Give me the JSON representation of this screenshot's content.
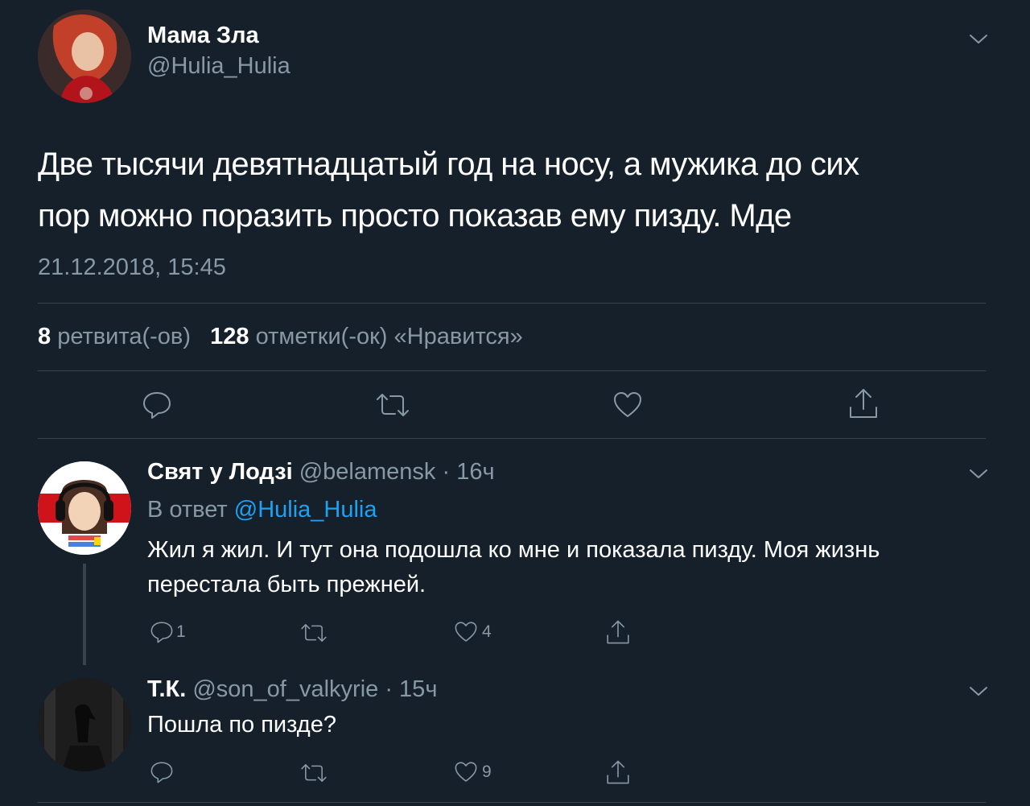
{
  "main_tweet": {
    "author_name": "Мама Зла",
    "author_handle": "@Hulia_Hulia",
    "text_line1": "Две тысячи девятнадцатый год на носу, а мужика до сих",
    "text_line2": "пор можно поразить просто показав ему пизду. Мде",
    "timestamp": "21.12.2018, 15:45",
    "retweets_count": "8",
    "retweets_label": "ретвита(-ов)",
    "likes_count": "128",
    "likes_label": "отметки(-ок) «Нравится»",
    "actions": [
      "reply-icon",
      "retweet-icon",
      "like-icon",
      "share-icon"
    ]
  },
  "replies": [
    {
      "author_name": "Свят у Лодзі",
      "author_handle": "@belamensk",
      "time": "· 16ч",
      "reply_to_prefix": "В ответ",
      "reply_to_handle": "@Hulia_Hulia",
      "text_line1": "Жил я жил. И тут она подошла ко мне и показала пизду. Моя жизнь",
      "text_line2": "перестала быть прежней.",
      "reply_count": "1",
      "like_count": "4"
    },
    {
      "author_name": "Т.К.",
      "author_handle": "@son_of_valkyrie",
      "time": "· 15ч",
      "text_line1": "Пошла по пизде?",
      "like_count": "9"
    }
  ],
  "colors": {
    "background": "#15202b",
    "muted": "#8899a6",
    "link": "#1da1f2",
    "divider": "#38444d"
  }
}
